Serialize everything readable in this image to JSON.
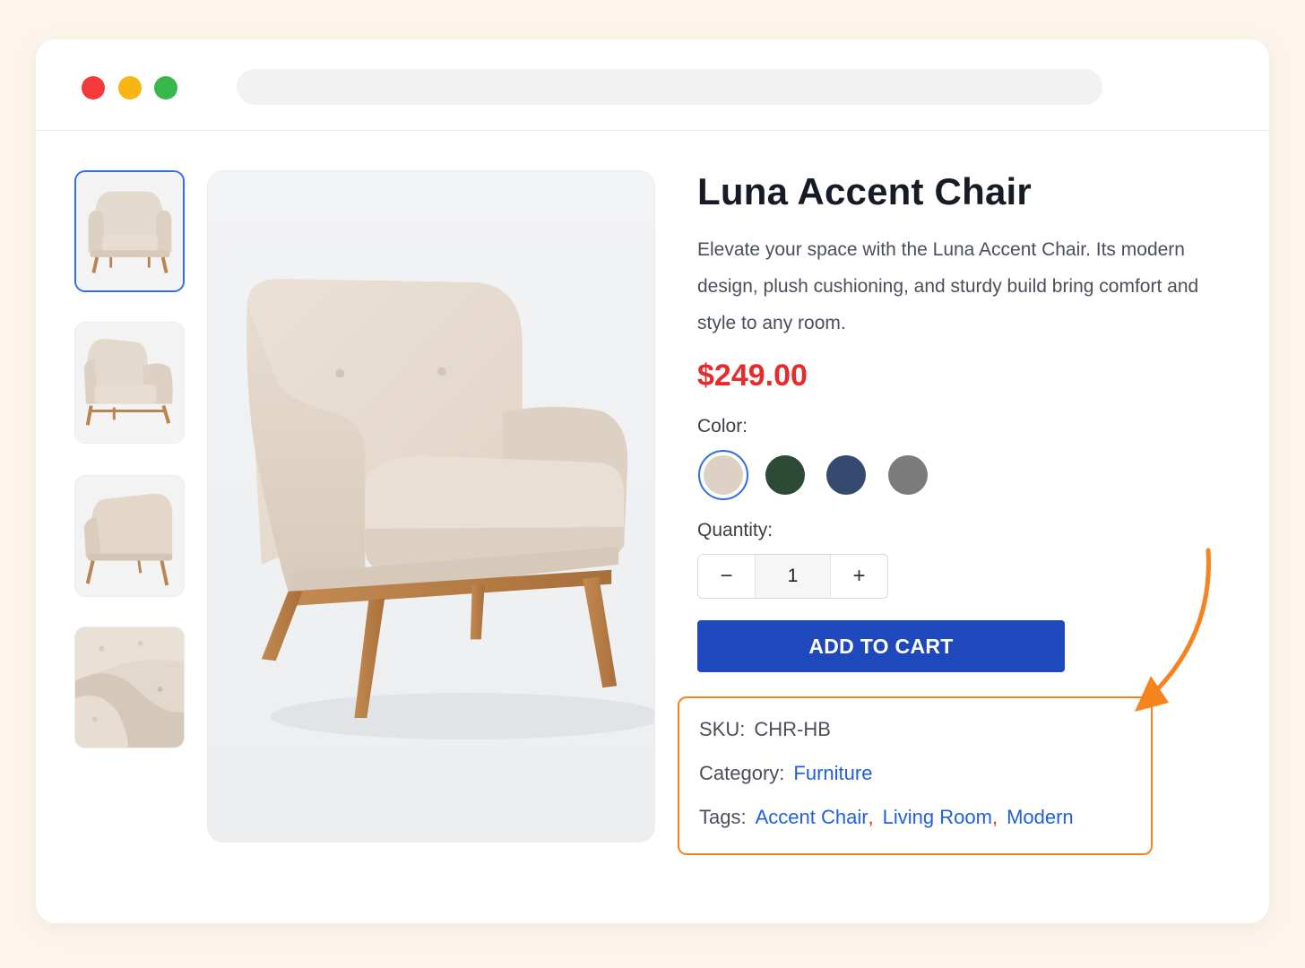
{
  "window": {
    "controls": [
      "close",
      "minimize",
      "maximize"
    ],
    "address_bar": ""
  },
  "gallery": {
    "thumbnails": [
      {
        "name": "front-view",
        "active": true
      },
      {
        "name": "angled-view",
        "active": false
      },
      {
        "name": "back-view",
        "active": false
      },
      {
        "name": "fabric-detail",
        "active": false
      }
    ],
    "main_image": "luna-accent-chair"
  },
  "product": {
    "title": "Luna Accent Chair",
    "description": "Elevate your space with the Luna Accent Chair. Its modern design, plush cushioning, and sturdy build bring comfort and style to any room.",
    "price": "$249.00",
    "color_label": "Color:",
    "colors": [
      {
        "name": "beige",
        "hex": "#ddd0c4",
        "selected": true
      },
      {
        "name": "dark-green",
        "hex": "#2c4a35",
        "selected": false
      },
      {
        "name": "navy",
        "hex": "#354a6f",
        "selected": false
      },
      {
        "name": "gray",
        "hex": "#7b7b7b",
        "selected": false
      }
    ],
    "quantity_label": "Quantity:",
    "quantity": "1",
    "decrement": "−",
    "increment": "+",
    "add_to_cart": "ADD TO CART"
  },
  "meta": {
    "sku_label": "SKU:",
    "sku": "CHR-HB",
    "category_label": "Category:",
    "category": "Furniture",
    "tags_label": "Tags:",
    "tags": [
      "Accent Chair",
      "Living Room",
      "Modern"
    ],
    "tag_separator": ","
  },
  "colors": {
    "accent": "#2048bd",
    "price": "#e52b2b",
    "highlight": "#f5841f",
    "link": "#1f5fe0"
  }
}
